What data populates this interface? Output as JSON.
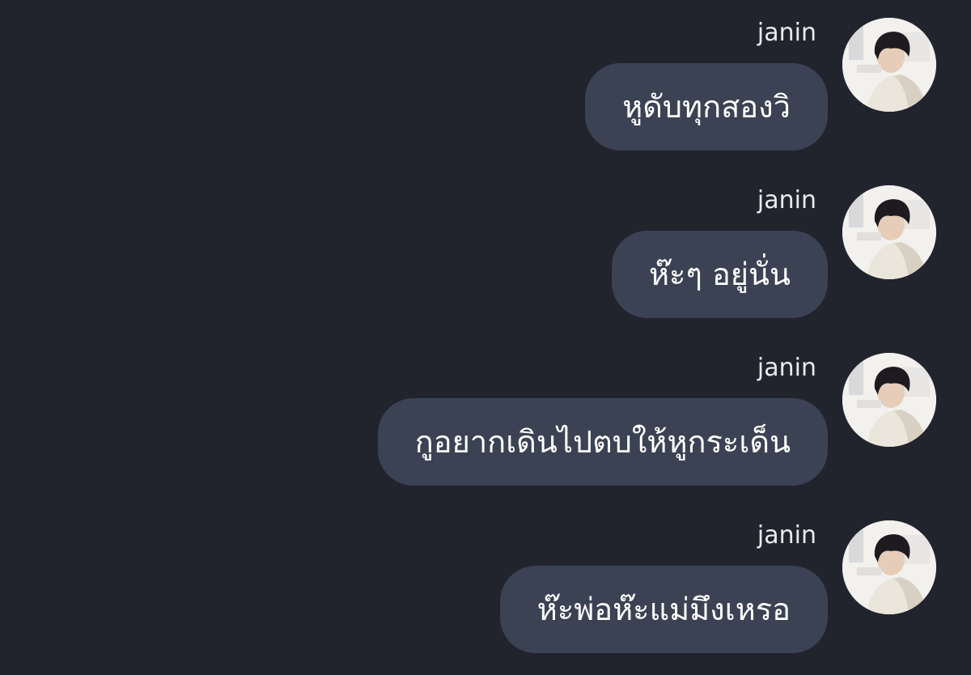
{
  "messages": [
    {
      "sender": "janin",
      "text": "หูดับทุกสองวิ"
    },
    {
      "sender": "janin",
      "text": "ห๊ะๆ อยู่นั่น"
    },
    {
      "sender": "janin",
      "text": "กูอยากเดินไปตบให้หูกระเด็น"
    },
    {
      "sender": "janin",
      "text": "ห๊ะพ่อห๊ะแม่มึงเหรอ"
    }
  ],
  "colors": {
    "background": "#22242d",
    "bubble": "#3a4253",
    "text": "#ffffff",
    "sender": "#e9eaee"
  }
}
